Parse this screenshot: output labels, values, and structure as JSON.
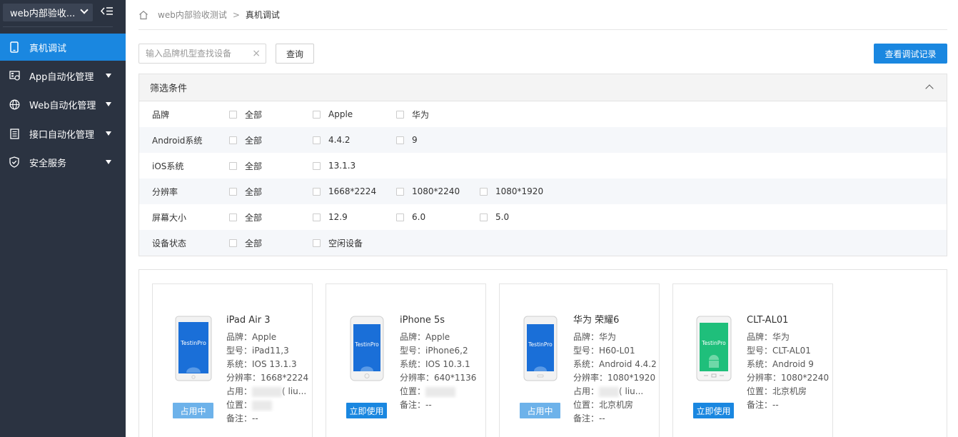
{
  "sidebar": {
    "project": "web内部验收...",
    "items": [
      {
        "label": "真机调试",
        "icon": "phone-icon",
        "active": true
      },
      {
        "label": "App自动化管理",
        "icon": "app-grid-icon"
      },
      {
        "label": "Web自动化管理",
        "icon": "globe-icon"
      },
      {
        "label": "接口自动化管理",
        "icon": "document-icon"
      },
      {
        "label": "安全服务",
        "icon": "shield-icon"
      }
    ]
  },
  "breadcrumb": {
    "parent": "web内部验收测试",
    "separator": ">",
    "current": "真机调试"
  },
  "toolbar": {
    "search_placeholder": "输入品牌机型查找设备",
    "clear": "×",
    "query_label": "查询",
    "record_label": "查看调试记录"
  },
  "filter": {
    "title": "筛选条件",
    "rows": [
      {
        "label": "品牌",
        "options": [
          "全部",
          "Apple",
          "华为"
        ]
      },
      {
        "label": "Android系统",
        "options": [
          "全部",
          "4.4.2",
          "9"
        ]
      },
      {
        "label": "iOS系统",
        "options": [
          "全部",
          "13.1.3"
        ]
      },
      {
        "label": "分辨率",
        "options": [
          "全部",
          "1668*2224",
          "1080*2240",
          "1080*1920"
        ]
      },
      {
        "label": "屏幕大小",
        "options": [
          "全部",
          "12.9",
          "6.0",
          "5.0"
        ]
      },
      {
        "label": "设备状态",
        "options": [
          "全部",
          "空闲设备"
        ]
      }
    ]
  },
  "devices": [
    {
      "name": "iPad Air 3",
      "brand": "品牌：Apple",
      "model": "型号：iPad11,3",
      "system": "系统：IOS 13.1.3",
      "resolution": "分辨率：1668*2224",
      "occupy": "占用：",
      "occupy_suffix": "( liu...",
      "location": "位置：",
      "remark": "备注：--",
      "status": "占用中",
      "status_type": "busy",
      "screen_color": "#1a6fd8",
      "logo": "TestinPro"
    },
    {
      "name": "iPhone 5s",
      "brand": "品牌：Apple",
      "model": "型号：iPhone6,2",
      "system": "系统：IOS 10.3.1",
      "resolution": "分辨率：640*1136",
      "location": "位置：",
      "remark": "备注：--",
      "status": "立即使用",
      "status_type": "free",
      "screen_color": "#1a6fd8",
      "logo": "TestinPro"
    },
    {
      "name": "华为 荣耀6",
      "brand": "品牌：华为",
      "model": "型号：H60-L01",
      "system": "系统：Android 4.4.2",
      "resolution": "分辨率：1080*1920",
      "occupy": "占用：",
      "occupy_suffix": "( liu...",
      "location": "位置：北京机房",
      "remark": "备注：--",
      "status": "占用中",
      "status_type": "busy",
      "screen_color": "#1a6fd8",
      "logo": "TestinPro"
    },
    {
      "name": "CLT-AL01",
      "brand": "品牌：华为",
      "model": "型号：CLT-AL01",
      "system": "系统：Android 9",
      "resolution": "分辨率：1080*2240",
      "location": "位置：北京机房",
      "remark": "备注：--",
      "status": "立即使用",
      "status_type": "free",
      "screen_color": "#1fbf7b",
      "logo": "TestinPro"
    }
  ],
  "colors": {
    "sidebar_bg": "#2b3341",
    "accent": "#1a87e0",
    "busy": "#6db2ea",
    "android_green": "#1fbf7b"
  }
}
